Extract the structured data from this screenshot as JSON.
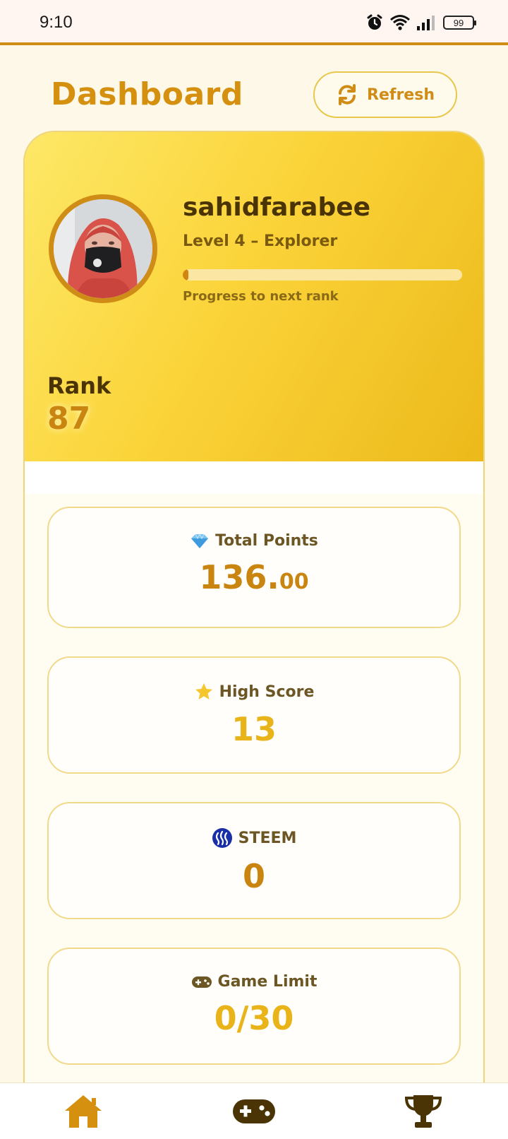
{
  "status_bar": {
    "time": "9:10",
    "battery": "99"
  },
  "header": {
    "title": "Dashboard",
    "refresh_label": "Refresh"
  },
  "profile": {
    "username": "sahidfarabee",
    "level": "Level 4 – Explorer",
    "progress": 0.02,
    "progress_label": "Progress to next rank",
    "rank_label": "Rank",
    "rank_value": "87"
  },
  "stats": [
    {
      "label": "Total Points",
      "value_int": "136.",
      "value_dec": "00",
      "icon": "gem-icon",
      "color": "#c9850f"
    },
    {
      "label": "High Score",
      "value": "13",
      "icon": "star-icon",
      "color": "#e8b419"
    },
    {
      "label": "STEEM",
      "value": "0",
      "icon": "steem-icon",
      "color": "#c9850f"
    },
    {
      "label": "Game Limit",
      "value": "0/30",
      "icon": "gamepad-icon",
      "color": "#e8b419"
    }
  ],
  "colors": {
    "accent": "#cf8d17",
    "hero_start": "#fde867",
    "hero_end": "#ecb91a",
    "nav_icon": "#4a3406"
  },
  "nav": {
    "items": [
      "home-icon",
      "gamepad-icon",
      "trophy-icon"
    ]
  }
}
